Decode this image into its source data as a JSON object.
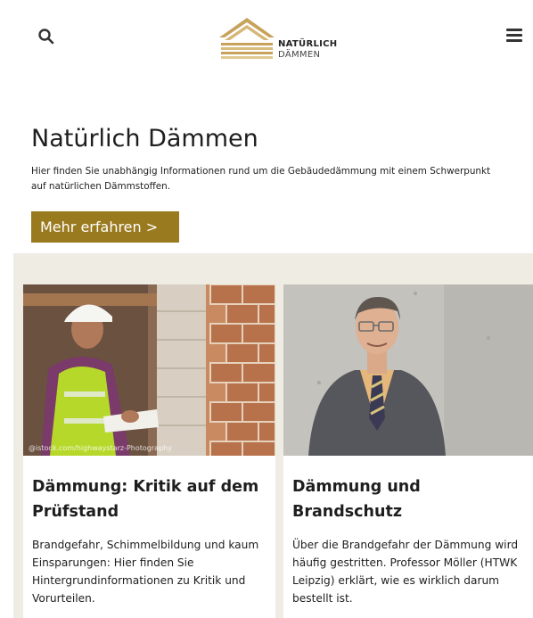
{
  "header": {
    "logo_line1": "NATÜRLICH",
    "logo_line2": "DÄMMEN",
    "search_icon": "search-icon",
    "menu_icon": "hamburger-menu-icon"
  },
  "hero": {
    "title": "Natürlich Dämmen",
    "text": "Hier finden Sie unabhängig Informationen rund um die Gebäudedämmung mit einem Schwerpunkt auf natürlichen Dämmstoffen.",
    "cta_label": "Mehr erfahren >"
  },
  "cards": [
    {
      "image_credit": "@istock.com/highwaystarz-Photography",
      "title": "Dämmung: Kritik auf dem Prüfstand",
      "text": "Brandgefahr, Schimmelbildung und kaum Einsparungen: Hier finden Sie Hintergrundinformationen zu Kritik und Vorurteilen."
    },
    {
      "title": "Dämmung und Brandschutz",
      "text": "Über die Brandgefahr der Dämmung wird häufig gestritten. Professor Möller (HTWK Leipzig) erklärt, wie es wirklich darum bestellt ist."
    }
  ],
  "colors": {
    "accent": "#9a7a1f",
    "band": "#eeece3",
    "text": "#1e1e1e"
  }
}
